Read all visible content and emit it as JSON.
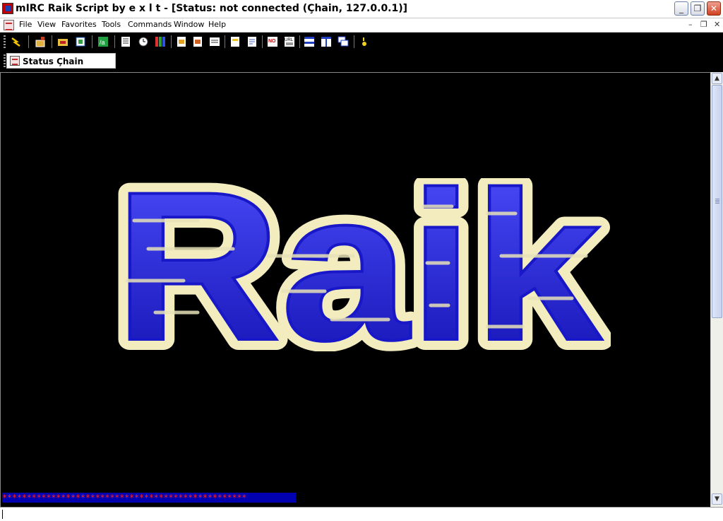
{
  "window": {
    "title": "mIRC Raik Script by e x l t - [Status: not connected (Çhain, 127.0.0.1)]"
  },
  "menu": {
    "items": [
      "File",
      "View",
      "Favorites",
      "Tools",
      "Commands",
      "Window",
      "Help"
    ]
  },
  "toolbar": {
    "buttons": [
      "connect-icon",
      "options-icon",
      "channels-folder-icon",
      "address-book-icon",
      "alias-icon",
      "script-editor-icon",
      "timer-icon",
      "colors-icon",
      "send-file-icon",
      "receive-file-icon",
      "dcc-chat-icon",
      "log-icon",
      "notify-icon",
      "no-icon",
      "url-list-icon",
      "tile-horizontal-icon",
      "tile-vertical-icon",
      "cascade-icon",
      "help-icon"
    ]
  },
  "switchbar": {
    "tab_label": "Status Çhain"
  },
  "status": {
    "logo_text": "Raik",
    "separator_line": "**************************************************"
  },
  "colors": {
    "background": "#000000",
    "logo_fill": "#2a2ad8",
    "logo_outline": "#f2ecbf",
    "separator_bg": "#0000b0",
    "separator_text": "#ff2020"
  }
}
